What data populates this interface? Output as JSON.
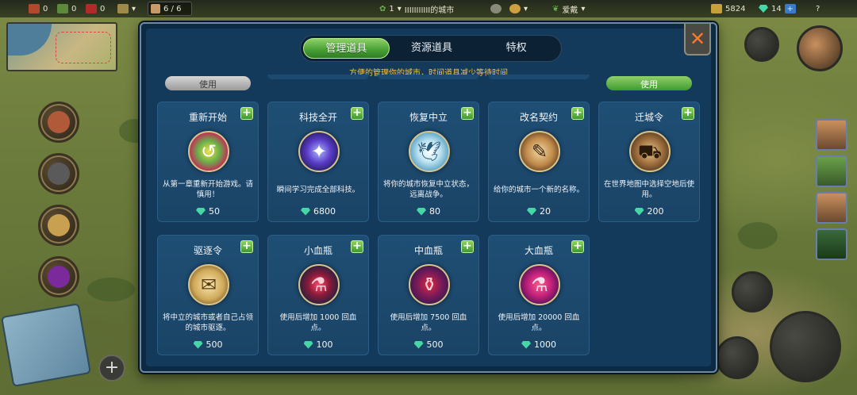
{
  "topbar": {
    "res1": "0",
    "res2": "0",
    "res3": "0",
    "troops": "6 / 6",
    "city_level": "1",
    "city_name": "IIIIIIIIIII的城市",
    "user": "爱戴",
    "coins": "5824",
    "gems": "14"
  },
  "tabs": [
    {
      "label": "管理道具",
      "active": true
    },
    {
      "label": "资源道具",
      "active": false
    },
    {
      "label": "特权",
      "active": false
    }
  ],
  "subtitle": "方便的管理你的城市，时间道具减少等待时间",
  "scrolled_buttons": [
    "使用",
    "使用"
  ],
  "cards": [
    {
      "title": "重新开始",
      "desc": "从第一章重新开始游戏。请慎用！",
      "price": "50",
      "icon": "restart-icon",
      "glyph": "↺",
      "color": "#c9205a"
    },
    {
      "title": "科技全开",
      "desc": "瞬间学习完成全部科技。",
      "price": "6800",
      "icon": "tech-icon",
      "glyph": "✦",
      "color": "#4b3aa8"
    },
    {
      "title": "恢复中立",
      "desc": "将你的城市恢复中立状态，远离战争。",
      "price": "80",
      "icon": "dove-icon",
      "glyph": "🕊",
      "color": "#3d8fb8"
    },
    {
      "title": "改名契约",
      "desc": "给你的城市一个新的名称。",
      "price": "20",
      "icon": "quill-icon",
      "glyph": "✎",
      "color": "#8a5a2e"
    },
    {
      "title": "迁城令",
      "desc": "在世界地图中选择空地后使用。",
      "price": "200",
      "icon": "wagon-icon",
      "glyph": "⛟",
      "color": "#6b5a3a"
    },
    {
      "title": "驱逐令",
      "desc": "将中立的城市或者自己占领的城市驱逐。",
      "price": "500",
      "icon": "map-icon",
      "glyph": "✉",
      "color": "#b89a5a"
    },
    {
      "title": "小血瓶",
      "desc": "使用后增加 1000 回血点。",
      "price": "100",
      "icon": "small-potion-icon",
      "glyph": "⚗",
      "color": "#2a3e6a"
    },
    {
      "title": "中血瓶",
      "desc": "使用后增加 7500 回血点。",
      "price": "500",
      "icon": "medium-potion-icon",
      "glyph": "⚱",
      "color": "#4a2a7a"
    },
    {
      "title": "大血瓶",
      "desc": "使用后增加 20000 回血点。",
      "price": "1000",
      "icon": "large-potion-icon",
      "glyph": "⚗",
      "color": "#8a2060"
    }
  ],
  "colors": {
    "accent_green": "#4aa236",
    "panel_blue": "#133a5a",
    "card_blue": "#1f4e74",
    "subtitle_gold": "#f3c64a",
    "close_orange": "#ff7a2a"
  }
}
